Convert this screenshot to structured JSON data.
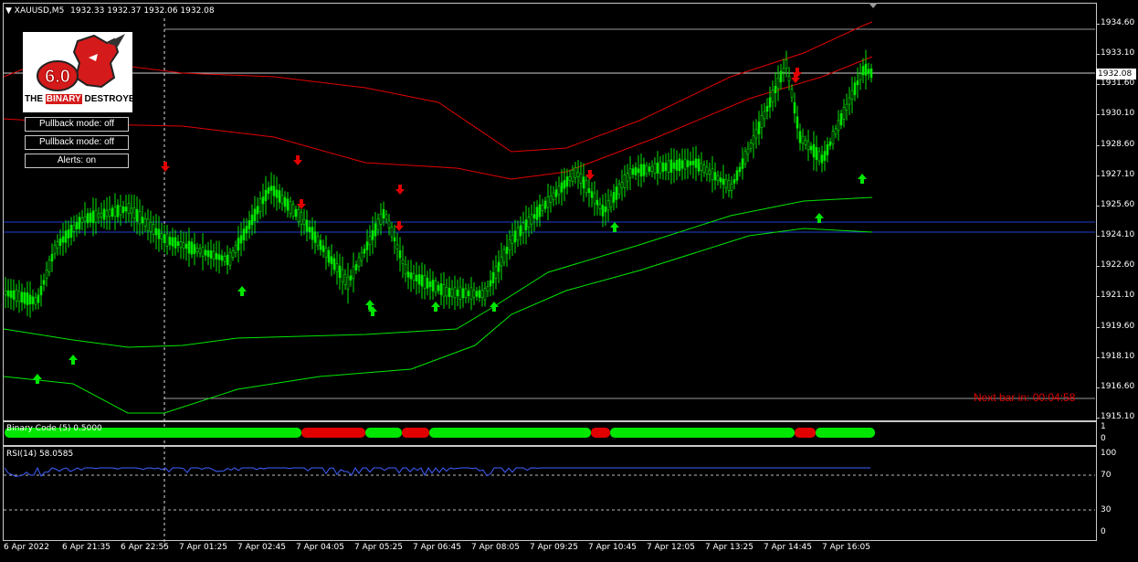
{
  "header": {
    "symbol": "XAUUSD,M5",
    "ohlc": "1932.33 1932.37 1932.06 1932.08"
  },
  "logo": {
    "version": "6.0",
    "name_part1": "THE",
    "name_part2": "BINARY",
    "name_part3": "DESTROYER"
  },
  "buttons": {
    "pullback1": "Pullback mode: off",
    "pullback2": "Pullback mode: off",
    "alerts": "Alerts: on"
  },
  "price_scale": [
    "1934.60",
    "1933.10",
    "1931.60",
    "1930.10",
    "1928.60",
    "1927.10",
    "1925.60",
    "1924.10",
    "1922.60",
    "1921.10",
    "1919.60",
    "1918.10",
    "1916.60",
    "1915.10"
  ],
  "current_price": "1932.08",
  "next_bar": "Next bar in: 00:04:58",
  "binary_pane": {
    "label": "Binary Code (5) 0.5000",
    "scale_top": "1",
    "scale_bottom": "0"
  },
  "rsi_pane": {
    "label": "RSI(14) 58.0585",
    "levels": [
      "100",
      "70",
      "30",
      "0"
    ]
  },
  "time_axis": [
    "6 Apr 2022",
    "6 Apr 21:35",
    "6 Apr 22:55",
    "7 Apr 01:25",
    "7 Apr 02:45",
    "7 Apr 04:05",
    "7 Apr 05:25",
    "7 Apr 06:45",
    "7 Apr 08:05",
    "7 Apr 09:25",
    "7 Apr 10:45",
    "7 Apr 12:05",
    "7 Apr 13:25",
    "7 Apr 14:45",
    "7 Apr 16:05"
  ],
  "colors": {
    "bull": "#00e600",
    "bear_band": "#e00000",
    "support": "#1f3fd0",
    "rsi": "#4060ff",
    "grid_line": "#9a9a9a",
    "next_bar": "#e00000"
  }
}
